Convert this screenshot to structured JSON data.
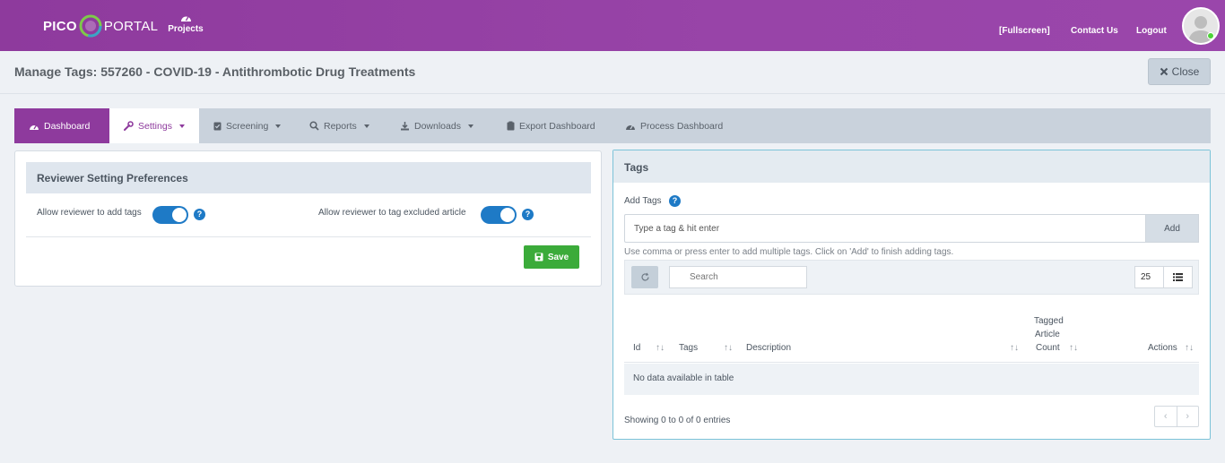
{
  "brand": {
    "pico": "PICO",
    "portal": "PORTAL"
  },
  "nav": {
    "projects": "Projects"
  },
  "top_links": {
    "fullscreen": "[Fullscreen]",
    "contact": "Contact Us",
    "logout": "Logout"
  },
  "page": {
    "title": "Manage Tags: 557260 - COVID-19 - Antithrombotic Drug Treatments",
    "close": "Close"
  },
  "tabs": [
    {
      "label": "Dashboard",
      "icon": "dashboard-icon"
    },
    {
      "label": "Settings",
      "icon": "wrench-icon"
    },
    {
      "label": "Screening",
      "icon": "clipboard-check-icon"
    },
    {
      "label": "Reports",
      "icon": "search-icon"
    },
    {
      "label": "Downloads",
      "icon": "download-icon"
    },
    {
      "label": "Export Dashboard",
      "icon": "clipboard-icon"
    },
    {
      "label": "Process Dashboard",
      "icon": "dashboard-icon"
    }
  ],
  "reviewer": {
    "title": "Reviewer Setting Preferences",
    "allow_add": "Allow reviewer to add tags",
    "allow_excluded": "Allow reviewer to tag excluded article",
    "save": "Save"
  },
  "tags": {
    "title": "Tags",
    "add_label": "Add Tags",
    "input_placeholder": "Type a tag & hit enter",
    "add_button": "Add",
    "hint": "Use comma or press enter to add multiple tags. Click on 'Add' to finish adding tags.",
    "search_placeholder": "Search",
    "per_page": "25",
    "columns": {
      "id": "Id",
      "tags": "Tags",
      "description": "Description",
      "count_1": "Tagged",
      "count_2": "Article",
      "count_3": "Count",
      "actions": "Actions"
    },
    "empty": "No data available in table",
    "showing": "Showing 0 to 0 of 0 entries"
  },
  "colors": {
    "brand": "#8e3a9d",
    "toggle": "#1e7ac6",
    "save": "#3bab3a"
  }
}
